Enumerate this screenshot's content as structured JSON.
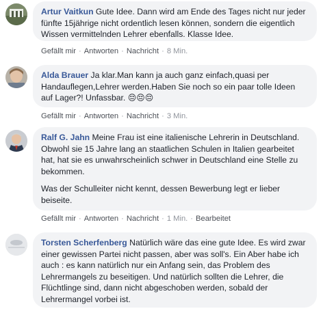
{
  "comments": [
    {
      "author": "Artur Vaitkun",
      "text": "Gute Idee. Dann wird am Ende des Tages nicht nur jeder fünfte 15jährige nicht ordentlich lesen können, sondern die eigentlich Wissen vermittelnden Lehrer ebenfalls. Klasse Idee.",
      "actions": {
        "like": "Gefällt mir",
        "reply": "Antworten",
        "message": "Nachricht",
        "time": "8 Min."
      }
    },
    {
      "author": "Alda Brauer",
      "text": "Ja klar.Man kann ja auch ganz einfach,quasi per Handauflegen,Lehrer werden.Haben Sie noch so ein paar tolle Ideen auf Lager?! Unfassbar.",
      "emoji": "😔😔😔",
      "actions": {
        "like": "Gefällt mir",
        "reply": "Antworten",
        "message": "Nachricht",
        "time": "3 Min."
      }
    },
    {
      "author": "Ralf G. Jahn",
      "text": "Meine Frau ist eine italienische Lehrerin in Deutschland. Obwohl sie 15 Jahre lang an staatlichen Schulen in Italien gearbeitet hat, hat sie es unwahrscheinlich schwer in Deutschland eine Stelle zu bekommen.",
      "text2": "Was der Schulleiter nicht kennt, dessen Bewerbung legt er lieber beiseite.",
      "actions": {
        "like": "Gefällt mir",
        "reply": "Antworten",
        "message": "Nachricht",
        "time": "1 Min.",
        "edited": "Bearbeitet"
      }
    },
    {
      "author": "Torsten Scherfenberg",
      "text": "Natürlich wäre das eine gute Idee. Es wird zwar einer gewissen Partei nicht passen, aber was soll's. Ein Aber habe ich auch : es kann natürlich nur ein Anfang sein, das Problem des Lehrermangels zu beseitigen. Und natürlich sollten die Lehrer, die Flüchtlinge sind, dann nicht abgeschoben werden, sobald der Lehrermangel vorbei ist."
    }
  ],
  "colors": {
    "author": "#385898",
    "bubble": "#f2f3f5",
    "meta": "#90949c"
  }
}
